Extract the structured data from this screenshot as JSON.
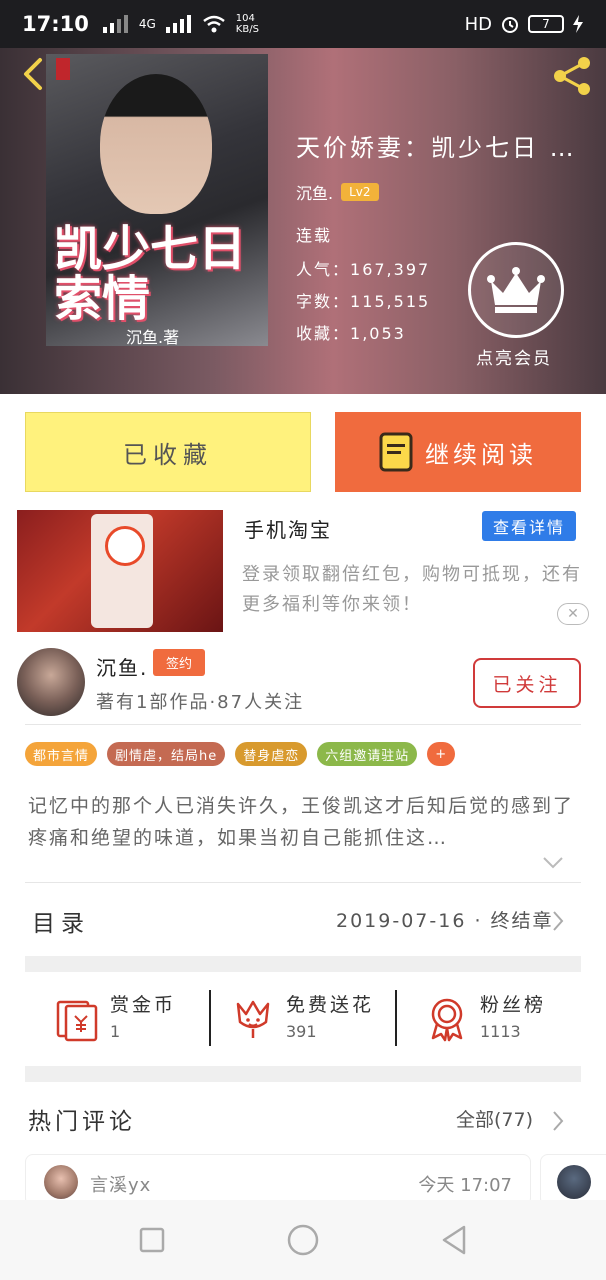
{
  "status_bar": {
    "time": "17:10",
    "signal_label": "4G",
    "net_speed": "104",
    "net_speed_unit": "KB/S",
    "hd_label": "HD",
    "battery": "7"
  },
  "book": {
    "title": "天价娇妻：凯少七日 …",
    "author": "沉鱼.",
    "level": "Lv2",
    "status": "连载",
    "popularity_label": "人气：",
    "popularity": "167,397",
    "word_count_label": "字数：",
    "word_count": "115,515",
    "favorites_label": "收藏：",
    "favorites": "1,053",
    "cover_title": "凯少七日索情",
    "cover_author": "沉鱼.著",
    "vip_label": "点亮会员"
  },
  "actions": {
    "collected_label": "已收藏",
    "continue_label": "继续阅读"
  },
  "ad": {
    "title": "手机淘宝",
    "button_label": "查看详情",
    "description": "登录领取翻倍红包，购物可抵现，还有更多福利等你来领！",
    "close_label": "✕"
  },
  "author_section": {
    "name": "沉鱼.",
    "signed_badge": "签约",
    "stats": "著有1部作品·87人关注",
    "follow_label": "已关注"
  },
  "tags": [
    {
      "label": "都市言情",
      "color": "#f4a43a"
    },
    {
      "label": "剧情虐，结局he",
      "color": "#c46a52"
    },
    {
      "label": "替身虐恋",
      "color": "#d89a2e"
    },
    {
      "label": "六组邀请驻站",
      "color": "#8cb84a"
    },
    {
      "label": "+",
      "color": "#f06b3e"
    }
  ],
  "synopsis": "记忆中的那个人已消失许久，王俊凯这才后知后觉的感到了疼痛和绝望的味道，如果当初自己能抓住这…",
  "toc": {
    "label": "目录",
    "latest": "2019-07-16 · 终结章"
  },
  "rewards": [
    {
      "label": "赏金币",
      "value": "1",
      "icon": "red-envelope-icon"
    },
    {
      "label": "免费送花",
      "value": "391",
      "icon": "flower-icon"
    },
    {
      "label": "粉丝榜",
      "value": "1113",
      "icon": "medal-icon"
    }
  ],
  "comments": {
    "section_label": "热门评论",
    "all_label": "全部(77)",
    "items": [
      {
        "user": "言溪yx",
        "time": "今天 17:07"
      }
    ]
  },
  "colors": {
    "accent_orange": "#f06b3e",
    "collected_yellow": "#fff27d",
    "follow_red": "#d03a3a",
    "ad_blue": "#2f7ce8",
    "icon_red": "#d03a2a"
  }
}
